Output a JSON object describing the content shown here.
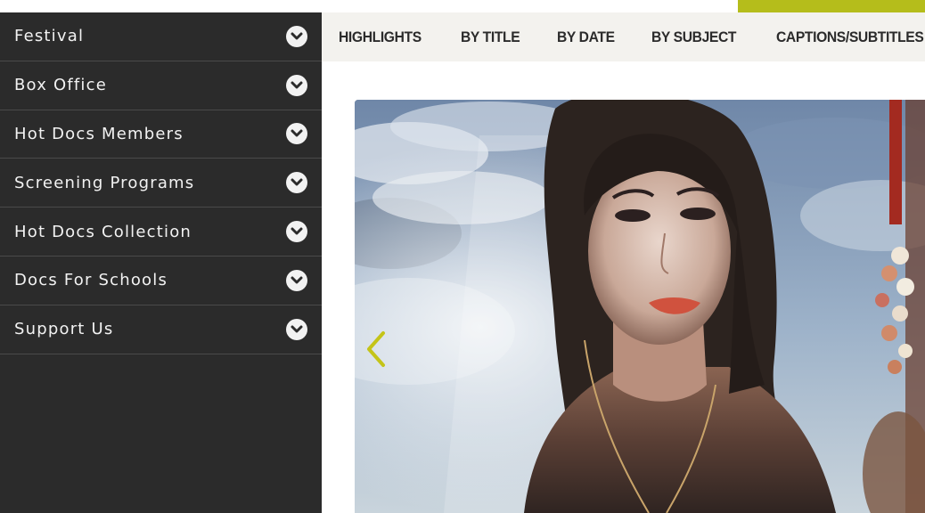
{
  "sidebar": {
    "items": [
      {
        "label": "Festival",
        "icon": "chevron-circle-down-icon"
      },
      {
        "label": "Box Office",
        "icon": "chevron-circle-down-icon"
      },
      {
        "label": "Hot Docs Members",
        "icon": "chevron-circle-down-icon"
      },
      {
        "label": "Screening Programs",
        "icon": "chevron-circle-down-icon"
      },
      {
        "label": "Hot Docs Collection",
        "icon": "chevron-circle-down-icon"
      },
      {
        "label": "Docs For Schools",
        "icon": "chevron-circle-down-icon"
      },
      {
        "label": "Support Us",
        "icon": "chevron-circle-down-icon"
      }
    ]
  },
  "subnav": {
    "items": [
      "HIGHLIGHTS",
      "BY TITLE",
      "BY DATE",
      "BY SUBJECT",
      "CAPTIONS/SUBTITLES"
    ]
  },
  "carousel": {
    "prev_icon": "chevron-left-icon",
    "accent_color": "#c4c418"
  },
  "colors": {
    "sidebar_bg": "#2b2b2b",
    "brand_accent": "#b5bd1b",
    "subnav_bg": "#f3f2ee"
  }
}
